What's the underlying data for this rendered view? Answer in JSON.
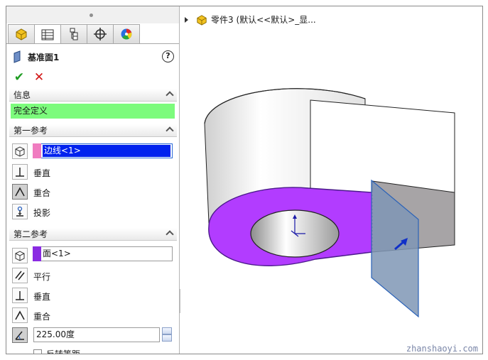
{
  "feature": {
    "title": "基准面1",
    "help": "?",
    "ok": "✔",
    "cancel": "✕"
  },
  "tabs": [
    {
      "name": "feature-manager-tab"
    },
    {
      "name": "property-manager-tab"
    },
    {
      "name": "configuration-manager-tab"
    },
    {
      "name": "dimxpert-manager-tab"
    },
    {
      "name": "display-manager-tab"
    }
  ],
  "info": {
    "header": "信息",
    "status": "完全定义"
  },
  "first_reference": {
    "header": "第一参考",
    "selection": "边线<1>",
    "options": [
      "垂直",
      "重合",
      "投影"
    ]
  },
  "second_reference": {
    "header": "第二参考",
    "selection": "面<1>",
    "options": [
      "平行",
      "垂直",
      "重合"
    ],
    "angle_value": "225.00度",
    "flip_label": "反转等距"
  },
  "viewport": {
    "tree_label": "零件3 (默认<<默认>_显..."
  },
  "watermark": "zhanshaoyi.com",
  "colors": {
    "status_ok": "#7cfb7c",
    "selection_edge": "#f07cc0",
    "selection_face": "#8a2be2",
    "highlight_face": "#b23cff",
    "plane": "#7f97b5"
  }
}
